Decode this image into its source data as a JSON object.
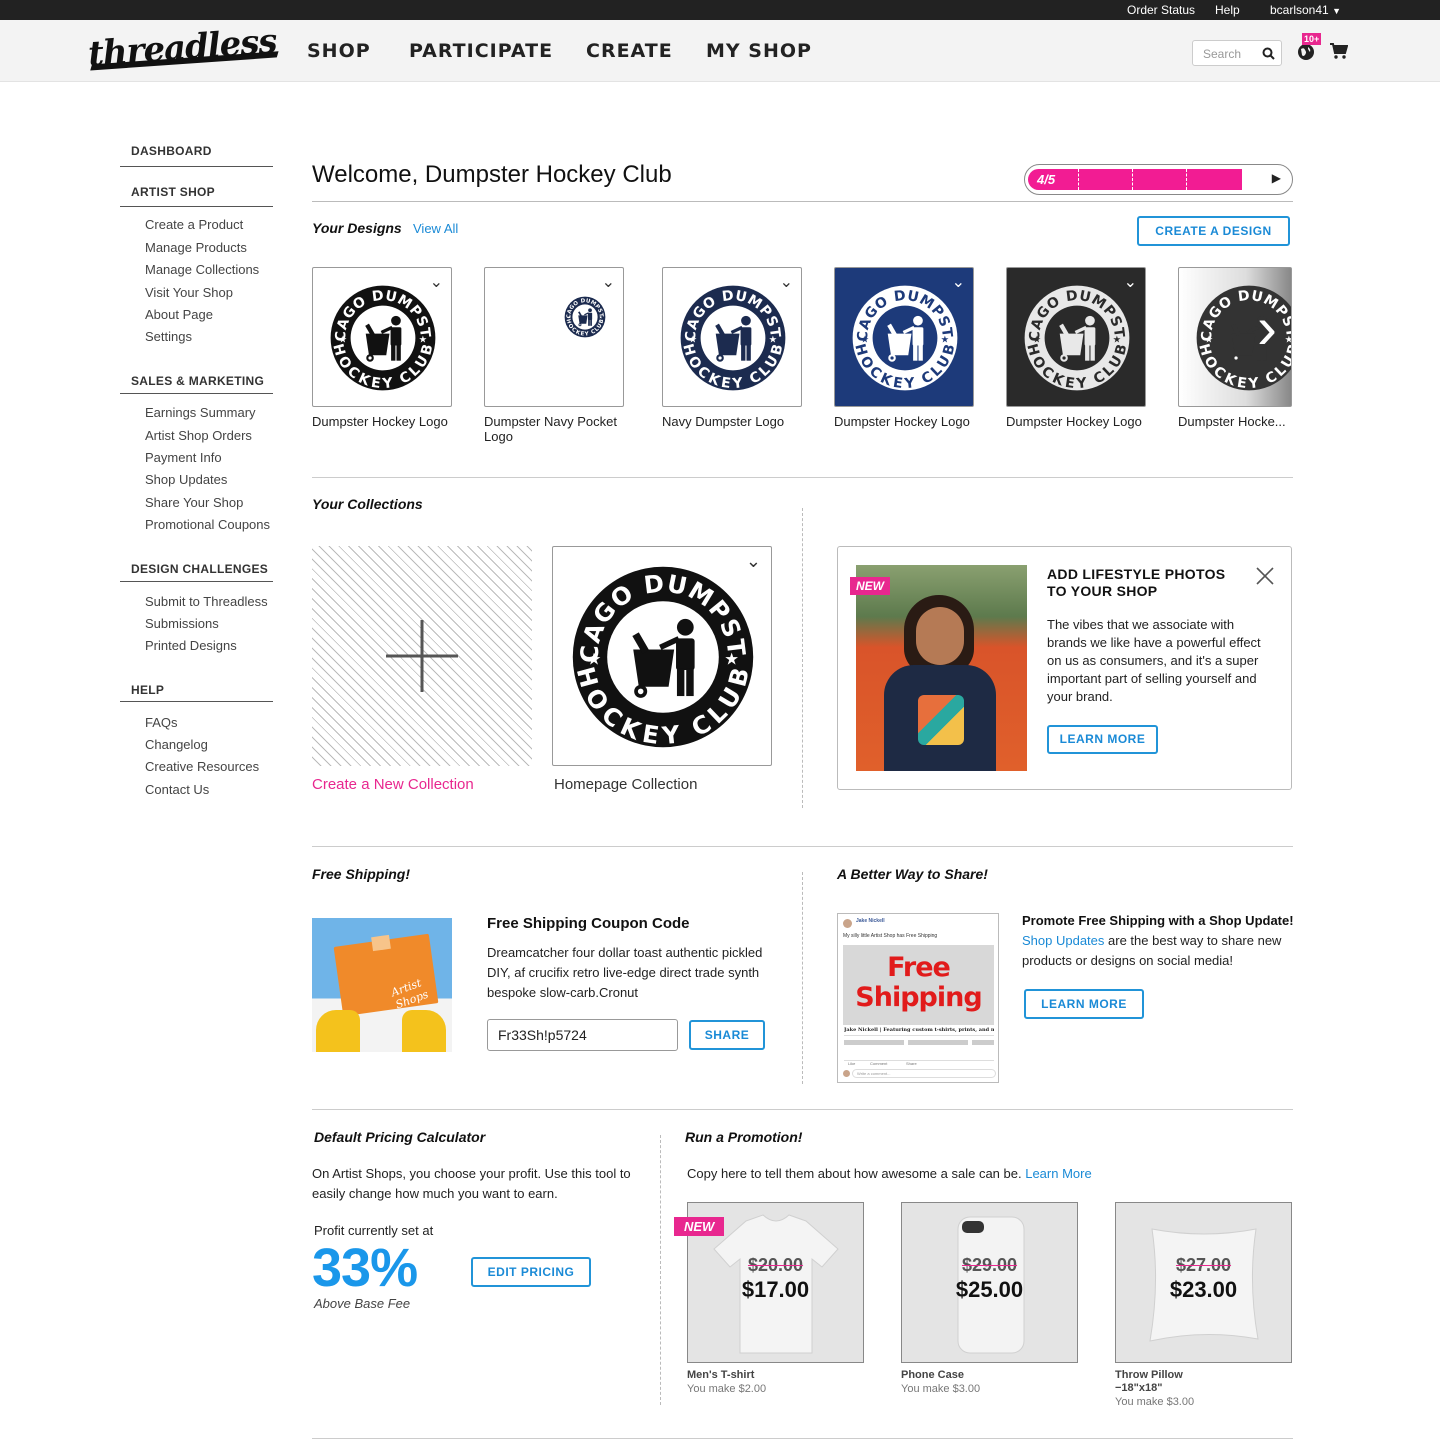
{
  "topbar": {
    "order_status": "Order Status",
    "help": "Help",
    "username": "bcarlson41"
  },
  "header": {
    "logo": "threadless",
    "nav": [
      "SHOP",
      "PARTICIPATE",
      "CREATE",
      "MY SHOP"
    ],
    "search_placeholder": "Search",
    "notification_count": "10+"
  },
  "sidebar": {
    "dashboard": "DASHBOARD",
    "artist_shop": {
      "heading": "ARTIST SHOP",
      "items": [
        "Create a Product",
        "Manage Products",
        "Manage Collections",
        "Visit Your Shop",
        "About Page",
        "Settings"
      ]
    },
    "sales_marketing": {
      "heading": "SALES & MARKETING",
      "items": [
        "Earnings Summary",
        "Artist Shop Orders",
        "Payment Info",
        "Shop Updates",
        "Share Your Shop",
        "Promotional Coupons"
      ]
    },
    "design_challenges": {
      "heading": "DESIGN CHALLENGES",
      "items": [
        "Submit to Threadless",
        "Submissions",
        "Printed Designs"
      ]
    },
    "help": {
      "heading": "HELP",
      "items": [
        "FAQs",
        "Changelog",
        "Creative Resources",
        "Contact Us"
      ]
    }
  },
  "welcome": {
    "title": "Welcome, Dumpster Hockey Club",
    "progress_label": "4/5",
    "progress_value": 0.8
  },
  "designs": {
    "title": "Your Designs",
    "view_all": "View All",
    "create_button": "CREATE A DESIGN",
    "items": [
      {
        "name": "Dumpster Hockey Logo"
      },
      {
        "name": "Dumpster Navy Pocket Logo"
      },
      {
        "name": "Navy Dumpster Logo"
      },
      {
        "name": "Dumpster Hockey Logo"
      },
      {
        "name": "Dumpster Hockey Logo"
      },
      {
        "name": "Dumpster Hocke..."
      }
    ],
    "logo_text_top": "CHICAGO DUMPSTERS",
    "logo_text_bottom": "HOCKEY CLUB"
  },
  "collections": {
    "title": "Your Collections",
    "create_label": "Create a New Collection",
    "homepage_label": "Homepage Collection"
  },
  "lifestyle": {
    "badge": "NEW",
    "title_line1": "ADD LIFESTYLE PHOTOS",
    "title_line2": "TO YOUR SHOP",
    "body": "The vibes that we associate with brands we like have a powerful effect on us as consumers, and it's a super important part of selling yourself and your brand.",
    "button": "LEARN MORE"
  },
  "free_shipping": {
    "section_title": "Free Shipping!",
    "heading": "Free Shipping Coupon Code",
    "body": "Dreamcatcher four dollar toast authentic pickled DIY, af crucifix retro live-edge direct trade synth bespoke slow-carb.Cronut",
    "coupon_code": "Fr33Sh!p5724",
    "share_button": "SHARE",
    "image_text": "Artist Shops"
  },
  "share": {
    "section_title": "A Better Way to Share!",
    "heading": "Promote Free Shipping with a Shop Update!",
    "link": "Shop Updates",
    "body": " are the best way to share new products or designs on social media!",
    "button": "LEARN MORE",
    "post": {
      "author": "Jake Nickell",
      "text": "My silly little Artist Shop has Free Shipping",
      "banner_line1": "Free",
      "banner_line2": "Shipping",
      "link_title": "Jake Nickell | Featuring custom t-shirts, prints, and more",
      "like": "Like",
      "comment": "Comment",
      "share": "Share",
      "comment_placeholder": "Write a comment..."
    }
  },
  "pricing": {
    "section_title": "Default Pricing Calculator",
    "body": "On Artist Shops, you choose your profit. Use this tool to easily change how much you want to earn.",
    "profit_label": "Profit currently set at",
    "percent": "33%",
    "sub_label": "Above Base Fee",
    "button": "EDIT PRICING"
  },
  "promotion": {
    "section_title": "Run a Promotion!",
    "body": "Copy here to tell them about how awesome a sale can be.",
    "link": "Learn More",
    "products": [
      {
        "badge": "NEW",
        "old_price": "$20.00",
        "new_price": "$17.00",
        "name": "Men's T-shirt",
        "make": "You make $2.00"
      },
      {
        "old_price": "$29.00",
        "new_price": "$25.00",
        "name": "Phone Case",
        "make": "You make $3.00"
      },
      {
        "old_price": "$27.00",
        "new_price": "$23.00",
        "name": "Throw Pillow\n−18\"x18\"",
        "make": "You make $3.00"
      }
    ]
  },
  "colors": {
    "accent_blue": "#1a8ad6",
    "accent_pink": "#e8278f",
    "navy": "#1c2b4f"
  }
}
